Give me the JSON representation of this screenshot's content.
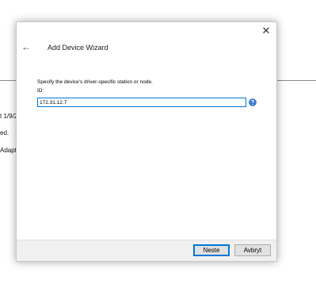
{
  "background": {
    "text_fragments": [
      "t 1/9/2",
      "ed.",
      "Adapt"
    ]
  },
  "dialog": {
    "title": "Add Device Wizard",
    "close_glyph": "✕",
    "back_glyph": "←",
    "instruction": "Specify the device's driver-specific station or node.",
    "id_label": "ID:",
    "id_value": "172.31.12.7",
    "help_icon": "help-icon",
    "buttons": {
      "next": "Neste",
      "cancel": "Avbryt"
    }
  },
  "colors": {
    "accent": "#0078d7",
    "footer": "#f0f0f0"
  }
}
